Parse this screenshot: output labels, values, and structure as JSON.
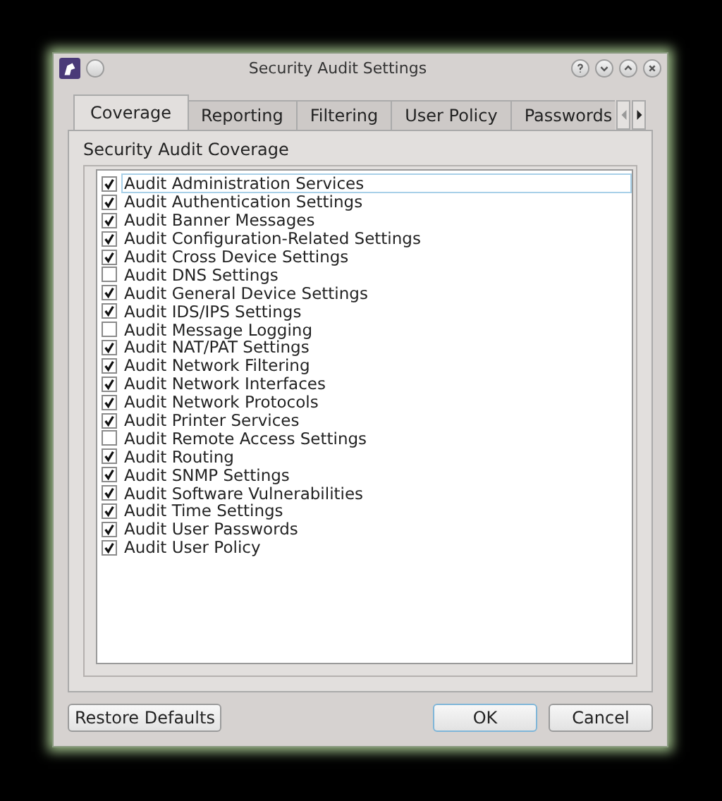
{
  "window": {
    "title": "Security Audit Settings"
  },
  "tabs": [
    {
      "label": "Coverage",
      "selected": true
    },
    {
      "label": "Reporting",
      "selected": false
    },
    {
      "label": "Filtering",
      "selected": false
    },
    {
      "label": "User Policy",
      "selected": false
    },
    {
      "label": "Passwords",
      "selected": false
    }
  ],
  "group": {
    "title": "Security Audit Coverage"
  },
  "items": [
    {
      "label": "Audit Administration Services",
      "checked": true,
      "selected": true
    },
    {
      "label": "Audit Authentication Settings",
      "checked": true,
      "selected": false
    },
    {
      "label": "Audit Banner Messages",
      "checked": true,
      "selected": false
    },
    {
      "label": "Audit Configuration-Related Settings",
      "checked": true,
      "selected": false
    },
    {
      "label": "Audit Cross Device Settings",
      "checked": true,
      "selected": false
    },
    {
      "label": "Audit DNS Settings",
      "checked": false,
      "selected": false
    },
    {
      "label": "Audit General Device Settings",
      "checked": true,
      "selected": false
    },
    {
      "label": "Audit IDS/IPS Settings",
      "checked": true,
      "selected": false
    },
    {
      "label": "Audit Message Logging",
      "checked": false,
      "selected": false
    },
    {
      "label": "Audit NAT/PAT Settings",
      "checked": true,
      "selected": false
    },
    {
      "label": "Audit Network Filtering",
      "checked": true,
      "selected": false
    },
    {
      "label": "Audit Network Interfaces",
      "checked": true,
      "selected": false
    },
    {
      "label": "Audit Network Protocols",
      "checked": true,
      "selected": false
    },
    {
      "label": "Audit Printer Services",
      "checked": true,
      "selected": false
    },
    {
      "label": "Audit Remote Access Settings",
      "checked": false,
      "selected": false
    },
    {
      "label": "Audit Routing",
      "checked": true,
      "selected": false
    },
    {
      "label": "Audit SNMP Settings",
      "checked": true,
      "selected": false
    },
    {
      "label": "Audit Software Vulnerabilities",
      "checked": true,
      "selected": false
    },
    {
      "label": "Audit Time Settings",
      "checked": true,
      "selected": false
    },
    {
      "label": "Audit User Passwords",
      "checked": true,
      "selected": false
    },
    {
      "label": "Audit User Policy",
      "checked": true,
      "selected": false
    }
  ],
  "buttons": [
    {
      "label": "Restore Defaults",
      "kind": "secondary"
    },
    {
      "label": "OK",
      "kind": "default"
    },
    {
      "label": "Cancel",
      "kind": "secondary"
    }
  ]
}
